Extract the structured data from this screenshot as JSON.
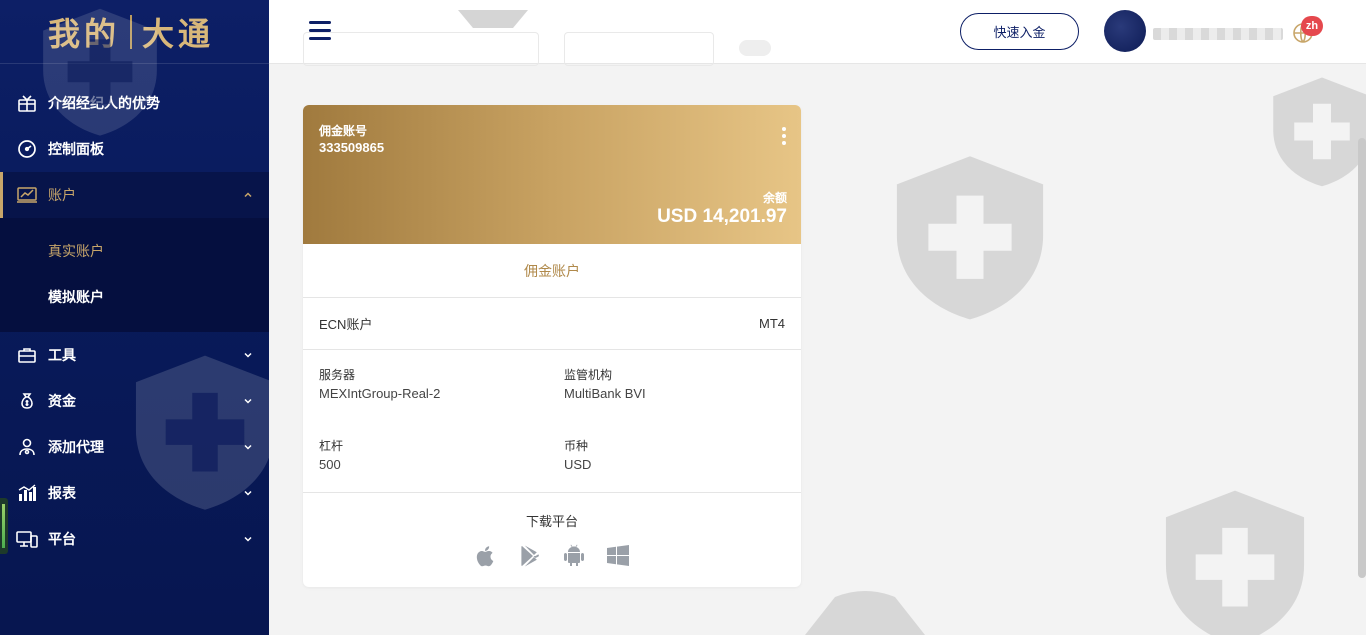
{
  "logo": {
    "part1": "我的",
    "part2": "大通"
  },
  "sidebar": {
    "items": [
      {
        "label": "介绍经纪人的优势",
        "icon": "gift-icon"
      },
      {
        "label": "控制面板",
        "icon": "dashboard-gauge-icon"
      },
      {
        "label": "账户",
        "icon": "accounts-chart-icon",
        "active": true
      },
      {
        "label": "工具",
        "icon": "briefcase-icon"
      },
      {
        "label": "资金",
        "icon": "money-bag-icon"
      },
      {
        "label": "添加代理",
        "icon": "add-agent-icon"
      },
      {
        "label": "报表",
        "icon": "bar-chart-icon"
      },
      {
        "label": "平台",
        "icon": "devices-icon"
      }
    ],
    "submenu": [
      {
        "label": "真实账户",
        "active": true
      },
      {
        "label": "模拟账户"
      }
    ]
  },
  "header": {
    "deposit_button": "快速入金",
    "lang_code": "zh"
  },
  "card": {
    "account_label": "佣金账号",
    "account_number": "333509865",
    "balance_label": "余额",
    "balance_value": "USD 14,201.97",
    "account_type": "佣金账户",
    "ecn_label": "ECN账户",
    "platform": "MT4",
    "server_label": "服务器",
    "server_value": "MEXIntGroup-Real-2",
    "regulator_label": "监管机构",
    "regulator_value": "MultiBank BVI",
    "leverage_label": "杠杆",
    "leverage_value": "500",
    "currency_label": "币种",
    "currency_value": "USD",
    "download_label": "下载平台",
    "download_icons": [
      "apple-icon",
      "google-play-icon",
      "android-icon",
      "windows-icon"
    ]
  },
  "colors": {
    "navy": "#0d1f66",
    "gold": "#c8a66a",
    "card_gradient_start": "#a07a3e",
    "card_gradient_end": "#e7c586"
  }
}
